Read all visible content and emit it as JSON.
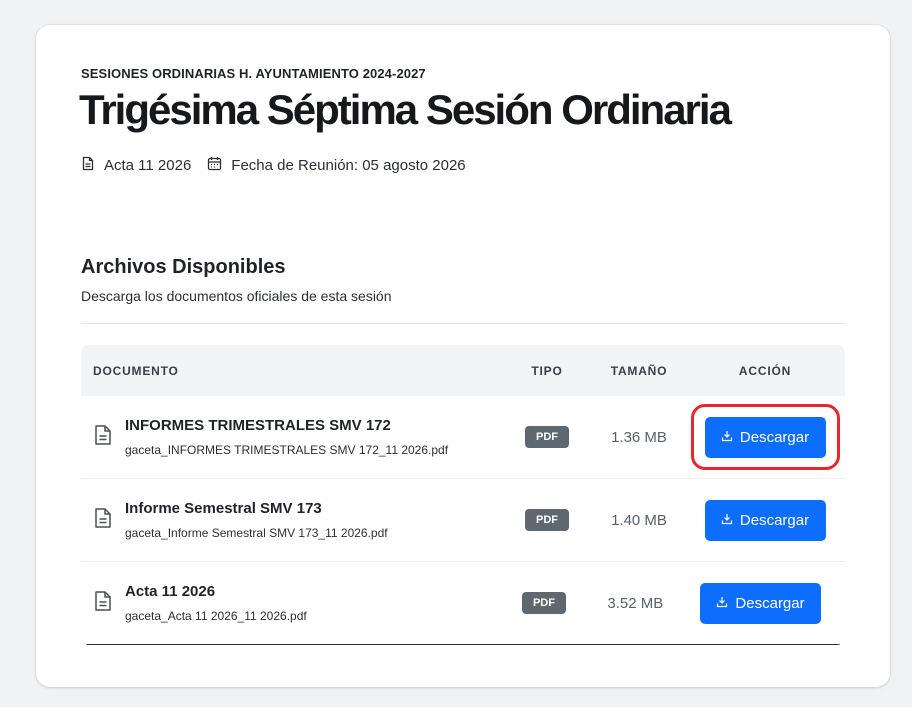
{
  "header": {
    "eyebrow": "SESIONES ORDINARIAS H. AYUNTAMIENTO 2024-2027",
    "title": "Trigésima Séptima Sesión Ordinaria",
    "acta": "Acta 11 2026",
    "fecha": "Fecha de Reunión: 05 agosto 2026"
  },
  "files_section": {
    "title": "Archivos Disponibles",
    "subtitle": "Descarga los documentos oficiales de esta sesión",
    "columns": {
      "documento": "DOCUMENTO",
      "tipo": "TIPO",
      "tamano": "TAMAÑO",
      "accion": "ACCIÓN"
    },
    "rows": [
      {
        "name": "INFORMES TRIMESTRALES SMV 172",
        "file": "gaceta_INFORMES TRIMESTRALES SMV 172_11 2026.pdf",
        "type": "PDF",
        "size": "1.36 MB",
        "action": "Descargar"
      },
      {
        "name": "Informe Semestral SMV 173",
        "file": "gaceta_Informe Semestral SMV 173_11 2026.pdf",
        "type": "PDF",
        "size": "1.40 MB",
        "action": "Descargar"
      },
      {
        "name": "Acta 11 2026",
        "file": "gaceta_Acta 11 2026_11 2026.pdf",
        "type": "PDF",
        "size": "3.52 MB",
        "action": "Descargar"
      }
    ]
  },
  "icons": {
    "acta": "document-icon",
    "fecha": "calendar-icon",
    "row": "file-text-icon",
    "button": "download-icon"
  },
  "colors": {
    "primary_button": "#0d6efd",
    "badge": "#5f6770",
    "highlight": "#e8262d"
  }
}
